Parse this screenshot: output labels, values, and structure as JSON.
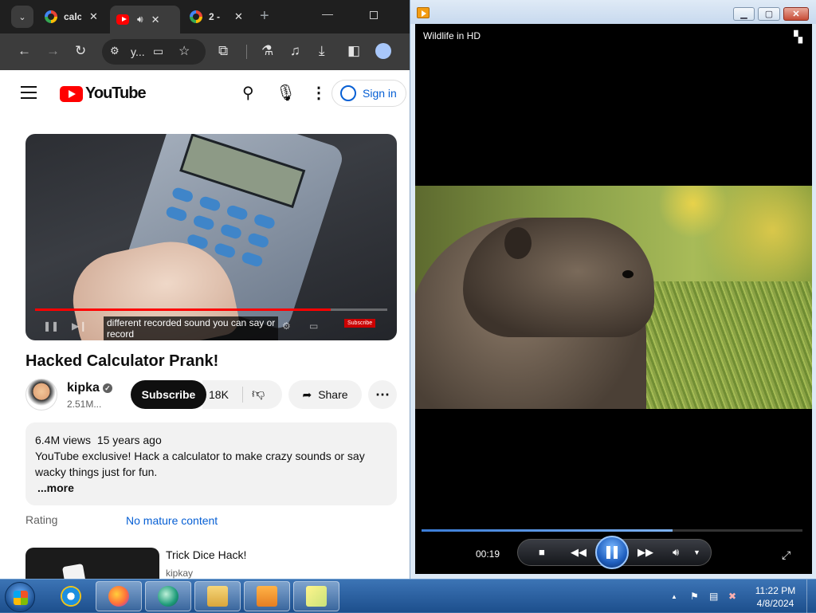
{
  "chrome": {
    "tabs": [
      {
        "title": "calc",
        "favicon": "google-icon",
        "active": false
      },
      {
        "title": "",
        "favicon": "youtube-icon",
        "audio": true,
        "active": true
      },
      {
        "title": "2 -",
        "favicon": "google-icon",
        "active": false
      }
    ],
    "omnibox_text": "y...",
    "tab_close": "✕",
    "new_tab": "+"
  },
  "youtube": {
    "logo_text": "YouTube",
    "sign_in": "Sign in",
    "player": {
      "caption_line1": "",
      "caption_line2": "different recorded sound you can say or",
      "caption_line3": "record",
      "progress_fraction": 0.84,
      "subscribe_watermark": "Subscribe"
    },
    "video_title": "Hacked Calculator Prank!",
    "channel_name": "kipka",
    "verified_mark": "✓",
    "channel_subs": "2.51M...",
    "subscribe_label": "Subscribe",
    "likes": "18K",
    "share_label": "Share",
    "more_actions": "⋯",
    "description": {
      "views": "6.4M views",
      "age": "15 years ago",
      "text_line1": "YouTube exclusive! Hack a calculator to make crazy sounds or say",
      "text_line2": "wacky things just for fun.",
      "more": "...more"
    },
    "rating_label": "Rating",
    "rating_value": "No mature content",
    "recommendation": {
      "title": "Trick Dice Hack!",
      "channel": "kipkay"
    }
  },
  "media_player": {
    "title": "Wildlife in HD",
    "elapsed": "00:19",
    "seek_fraction": 0.66,
    "accent": "#3b7dd8"
  },
  "taskbar": {
    "time": "11:22 PM",
    "date": "4/8/2024",
    "tray_expand": "▲"
  }
}
